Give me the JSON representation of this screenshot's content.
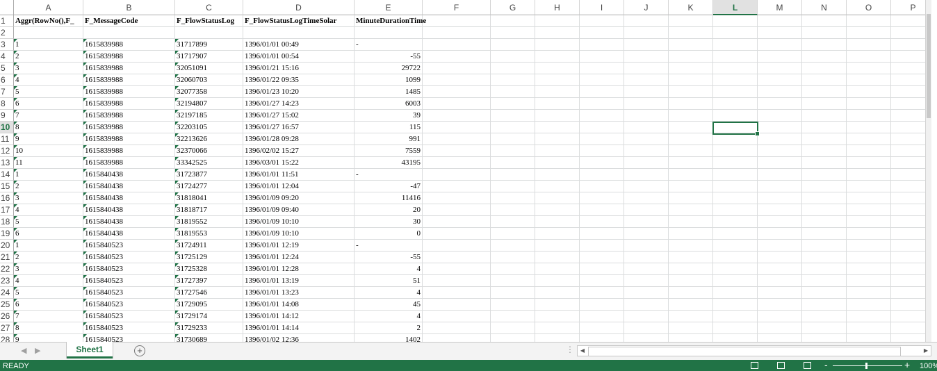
{
  "columns": [
    "A",
    "B",
    "C",
    "D",
    "E",
    "F",
    "G",
    "H",
    "I",
    "J",
    "K",
    "L",
    "M",
    "N",
    "O",
    "P"
  ],
  "selected_column": "L",
  "selected_row": "10",
  "header_row": {
    "row_num": "1",
    "A": "Aggr(RowNo(),F_",
    "B": "F_MessageCode",
    "C": "F_FlowStatusLog",
    "D": "F_FlowStatusLogTimeSolar",
    "E": "MinuteDurationTime"
  },
  "rows": [
    {
      "n": "2",
      "a": "",
      "b": "",
      "c": "",
      "d": "",
      "e": ""
    },
    {
      "n": "3",
      "a": "1",
      "b": "1615839988",
      "c": "31717899",
      "d": "1396/01/01 00:49",
      "e": "-"
    },
    {
      "n": "4",
      "a": "2",
      "b": "1615839988",
      "c": "31717907",
      "d": "1396/01/01 00:54",
      "e": "-55"
    },
    {
      "n": "5",
      "a": "3",
      "b": "1615839988",
      "c": "32051091",
      "d": "1396/01/21 15:16",
      "e": "29722"
    },
    {
      "n": "6",
      "a": "4",
      "b": "1615839988",
      "c": "32060703",
      "d": "1396/01/22 09:35",
      "e": "1099"
    },
    {
      "n": "7",
      "a": "5",
      "b": "1615839988",
      "c": "32077358",
      "d": "1396/01/23 10:20",
      "e": "1485"
    },
    {
      "n": "8",
      "a": "6",
      "b": "1615839988",
      "c": "32194807",
      "d": "1396/01/27 14:23",
      "e": "6003"
    },
    {
      "n": "9",
      "a": "7",
      "b": "1615839988",
      "c": "32197185",
      "d": "1396/01/27 15:02",
      "e": "39"
    },
    {
      "n": "10",
      "a": "8",
      "b": "1615839988",
      "c": "32203105",
      "d": "1396/01/27 16:57",
      "e": "115"
    },
    {
      "n": "11",
      "a": "9",
      "b": "1615839988",
      "c": "32213626",
      "d": "1396/01/28 09:28",
      "e": "991"
    },
    {
      "n": "12",
      "a": "10",
      "b": "1615839988",
      "c": "32370066",
      "d": "1396/02/02 15:27",
      "e": "7559"
    },
    {
      "n": "13",
      "a": "11",
      "b": "1615839988",
      "c": "33342525",
      "d": "1396/03/01 15:22",
      "e": "43195"
    },
    {
      "n": "14",
      "a": "1",
      "b": "1615840438",
      "c": "31723877",
      "d": "1396/01/01 11:51",
      "e": "-"
    },
    {
      "n": "15",
      "a": "2",
      "b": "1615840438",
      "c": "31724277",
      "d": "1396/01/01 12:04",
      "e": "-47"
    },
    {
      "n": "16",
      "a": "3",
      "b": "1615840438",
      "c": "31818041",
      "d": "1396/01/09 09:20",
      "e": "11416"
    },
    {
      "n": "17",
      "a": "4",
      "b": "1615840438",
      "c": "31818717",
      "d": "1396/01/09 09:40",
      "e": "20"
    },
    {
      "n": "18",
      "a": "5",
      "b": "1615840438",
      "c": "31819552",
      "d": "1396/01/09 10:10",
      "e": "30"
    },
    {
      "n": "19",
      "a": "6",
      "b": "1615840438",
      "c": "31819553",
      "d": "1396/01/09 10:10",
      "e": "0"
    },
    {
      "n": "20",
      "a": "1",
      "b": "1615840523",
      "c": "31724911",
      "d": "1396/01/01 12:19",
      "e": "-"
    },
    {
      "n": "21",
      "a": "2",
      "b": "1615840523",
      "c": "31725129",
      "d": "1396/01/01 12:24",
      "e": "-55"
    },
    {
      "n": "22",
      "a": "3",
      "b": "1615840523",
      "c": "31725328",
      "d": "1396/01/01 12:28",
      "e": "4"
    },
    {
      "n": "23",
      "a": "4",
      "b": "1615840523",
      "c": "31727397",
      "d": "1396/01/01 13:19",
      "e": "51"
    },
    {
      "n": "24",
      "a": "5",
      "b": "1615840523",
      "c": "31727546",
      "d": "1396/01/01 13:23",
      "e": "4"
    },
    {
      "n": "25",
      "a": "6",
      "b": "1615840523",
      "c": "31729095",
      "d": "1396/01/01 14:08",
      "e": "45"
    },
    {
      "n": "26",
      "a": "7",
      "b": "1615840523",
      "c": "31729174",
      "d": "1396/01/01 14:12",
      "e": "4"
    },
    {
      "n": "27",
      "a": "8",
      "b": "1615840523",
      "c": "31729233",
      "d": "1396/01/01 14:14",
      "e": "2"
    },
    {
      "n": "28",
      "a": "9",
      "b": "1615840523",
      "c": "31730689",
      "d": "1396/01/02 12:36",
      "e": "1402"
    }
  ],
  "tabs": {
    "sheet_name": "Sheet1",
    "add_sheet_icon": "plus-circle-icon"
  },
  "status": {
    "ready_text": "READY",
    "zoom_text": "100%",
    "zoom_minus": "-",
    "zoom_plus": "+"
  },
  "colors": {
    "accent": "#217346",
    "gridline": "#dadcdd"
  }
}
